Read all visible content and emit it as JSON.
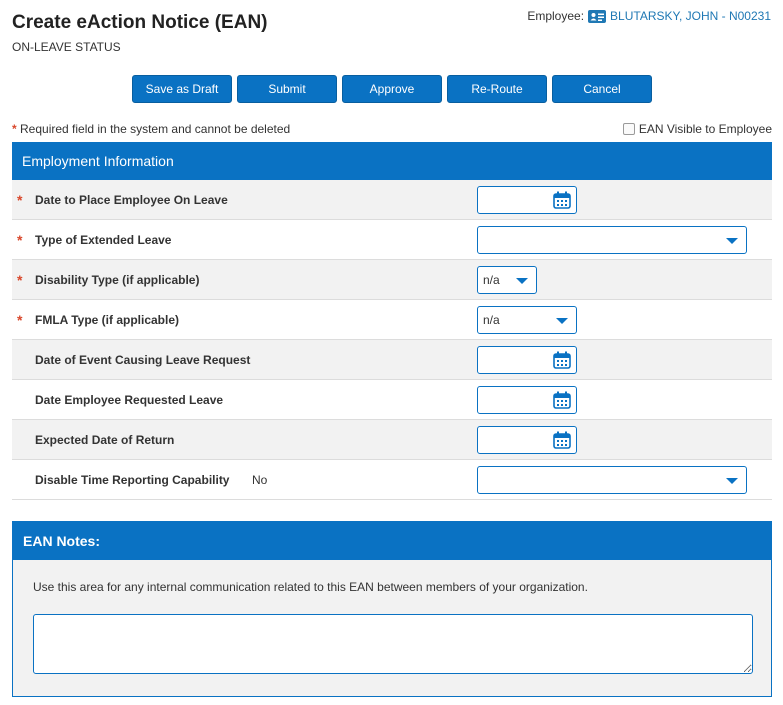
{
  "header": {
    "title": "Create eAction Notice (EAN)",
    "subtitle": "ON-LEAVE STATUS",
    "employee_label": "Employee:",
    "employee_name": "BLUTARSKY, JOHN - N00231"
  },
  "toolbar": {
    "buttons": [
      {
        "label": "Save as Draft"
      },
      {
        "label": "Submit"
      },
      {
        "label": "Approve"
      },
      {
        "label": "Re-Route"
      },
      {
        "label": "Cancel"
      }
    ]
  },
  "required_note": "Required field in the system and cannot be deleted",
  "required_marker": "*",
  "ean_visible_label": "EAN Visible to Employee",
  "employment": {
    "heading": "Employment Information",
    "fields": [
      {
        "label": "Date to Place Employee On Leave",
        "type": "date",
        "value": ""
      },
      {
        "label": "Type of Extended Leave",
        "type": "select",
        "value": ""
      },
      {
        "label": "Disability Type (if applicable)",
        "type": "select",
        "value": "n/a"
      },
      {
        "label": "FMLA Type (if applicable)",
        "type": "select",
        "value": "n/a"
      },
      {
        "label": "Date of Event Causing Leave Request",
        "type": "date",
        "value": ""
      },
      {
        "label": "Date Employee Requested Leave",
        "type": "date",
        "value": ""
      },
      {
        "label": "Expected Date of Return",
        "type": "date",
        "value": ""
      },
      {
        "label": "Disable Time Reporting Capability",
        "type": "select",
        "value": "",
        "current_value": "No"
      }
    ]
  },
  "notes": {
    "heading": "EAN Notes:",
    "hint": "Use this area for any internal communication related to this EAN between members of your organization.",
    "value": ""
  },
  "colors": {
    "primary": "#0a72c3",
    "link": "#1f78b4",
    "required": "#d9472b",
    "row_shade": "#f2f2f2"
  },
  "icons": {
    "employee": "id-card-icon",
    "date": "calendar-icon",
    "select": "chevron-down-icon"
  }
}
